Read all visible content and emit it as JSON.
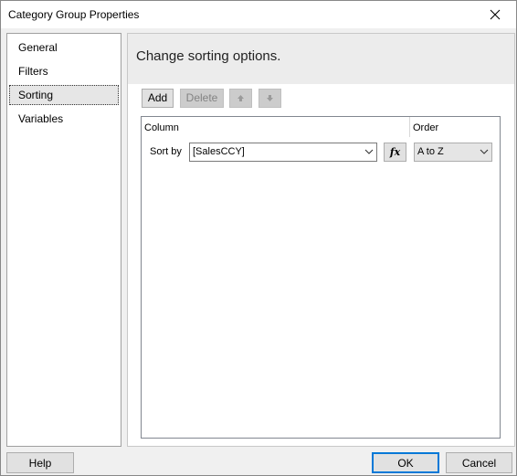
{
  "window": {
    "title": "Category Group Properties"
  },
  "nav": {
    "items": [
      {
        "label": "General",
        "selected": false
      },
      {
        "label": "Filters",
        "selected": false
      },
      {
        "label": "Sorting",
        "selected": true
      },
      {
        "label": "Variables",
        "selected": false
      }
    ]
  },
  "content": {
    "title": "Change sorting options.",
    "toolbar": {
      "add_label": "Add",
      "delete_label": "Delete",
      "move_up_icon": "arrow-up-icon",
      "move_down_icon": "arrow-down-icon"
    },
    "grid": {
      "column_header": "Column",
      "order_header": "Order",
      "rows": [
        {
          "label": "Sort by",
          "column_value": "[SalesCCY]",
          "order_value": "A to Z"
        }
      ],
      "fx_label": "fx"
    }
  },
  "footer": {
    "help_label": "Help",
    "ok_label": "OK",
    "cancel_label": "Cancel"
  },
  "colors": {
    "accent": "#0078d7",
    "header_bg": "#ececec",
    "selected_bg": "#e6e6e6"
  }
}
